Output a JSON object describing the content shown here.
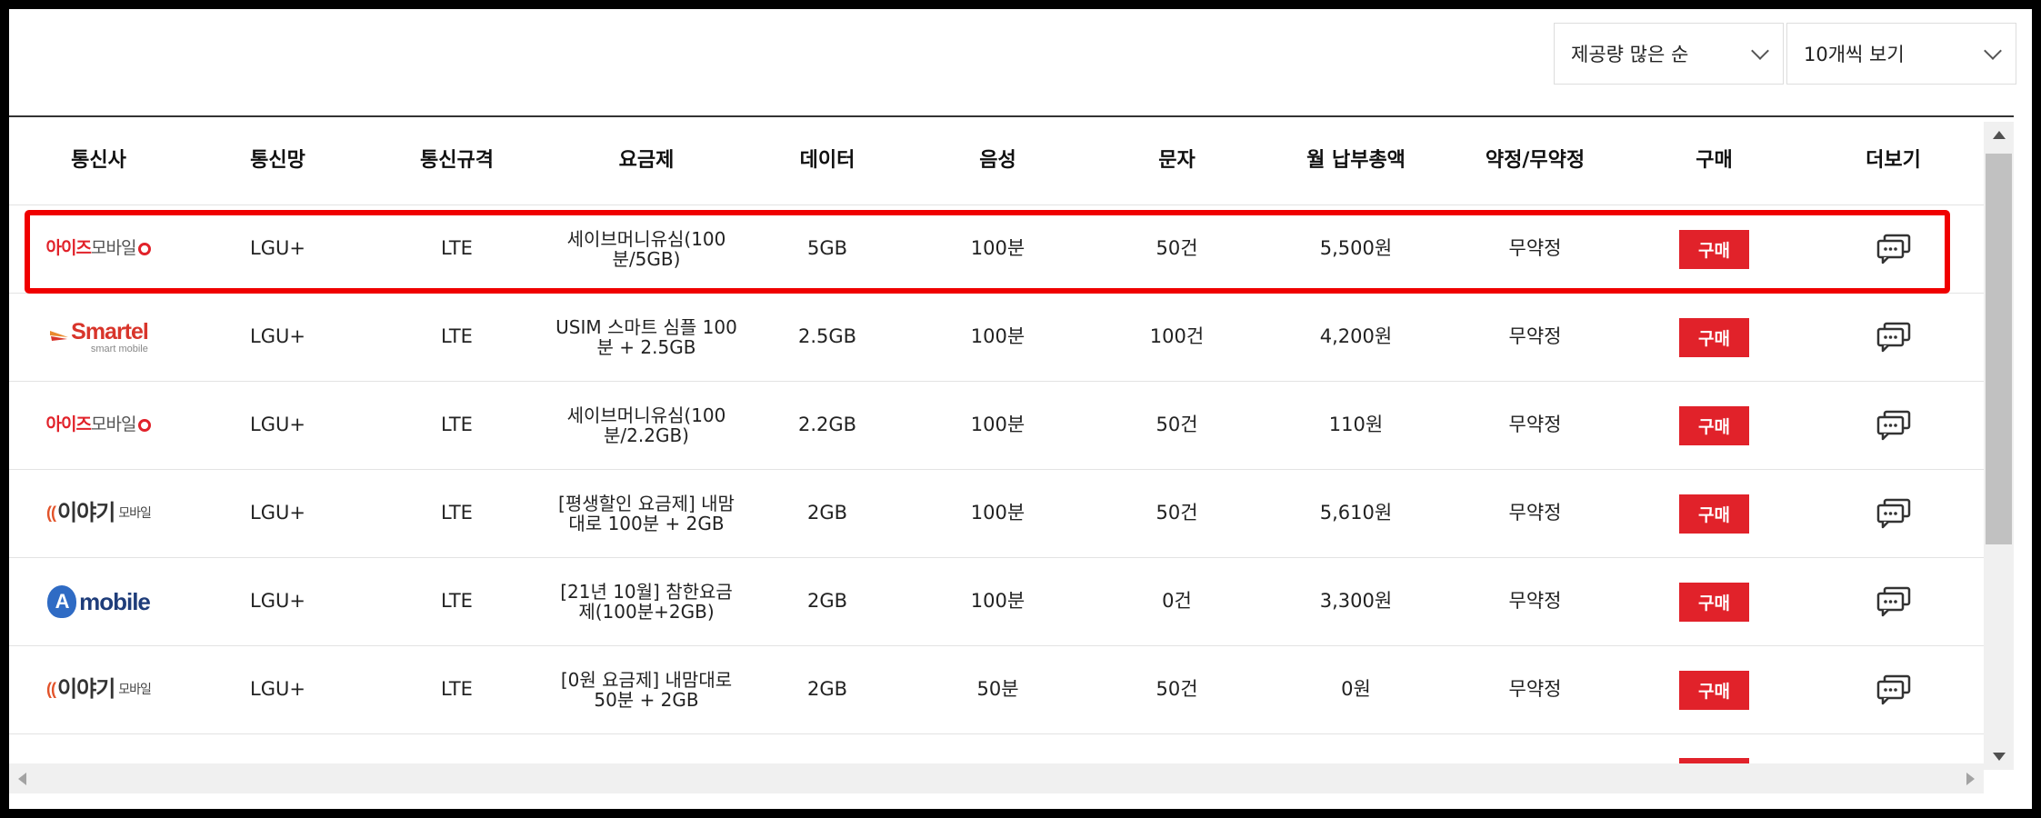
{
  "toolbar": {
    "sort_value": "제공량 많은 순",
    "count_value": "10개씩 보기"
  },
  "table": {
    "headers": [
      "통신사",
      "통신망",
      "통신규격",
      "요금제",
      "데이터",
      "음성",
      "문자",
      "월 납부총액",
      "약정/무약정",
      "구매",
      "더보기"
    ],
    "buy_label": "구매",
    "rows": [
      {
        "carrier": "아이즈모바일",
        "network": "LGU+",
        "standard": "LTE",
        "plan": "세이브머니유심(100분/5GB)",
        "data": "5GB",
        "voice": "100분",
        "sms": "50건",
        "monthly": "5,500원",
        "contract": "무약정"
      },
      {
        "carrier": "Smartel",
        "network": "LGU+",
        "standard": "LTE",
        "plan": "USIM 스마트 심플 100분 + 2.5GB",
        "data": "2.5GB",
        "voice": "100분",
        "sms": "100건",
        "monthly": "4,200원",
        "contract": "무약정"
      },
      {
        "carrier": "아이즈모바일",
        "network": "LGU+",
        "standard": "LTE",
        "plan": "세이브머니유심(100분/2.2GB)",
        "data": "2.2GB",
        "voice": "100분",
        "sms": "50건",
        "monthly": "110원",
        "contract": "무약정"
      },
      {
        "carrier": "이야기 모바일",
        "network": "LGU+",
        "standard": "LTE",
        "plan": "[평생할인 요금제] 내맘대로 100분 + 2GB",
        "data": "2GB",
        "voice": "100분",
        "sms": "50건",
        "monthly": "5,610원",
        "contract": "무약정"
      },
      {
        "carrier": "A mobile",
        "network": "LGU+",
        "standard": "LTE",
        "plan": "[21년 10월] 참한요금제(100분+2GB)",
        "data": "2GB",
        "voice": "100분",
        "sms": "0건",
        "monthly": "3,300원",
        "contract": "무약정"
      },
      {
        "carrier": "이야기 모바일",
        "network": "LGU+",
        "standard": "LTE",
        "plan": "[0원 요금제] 내맘대로 50분 + 2GB",
        "data": "2GB",
        "voice": "50분",
        "sms": "50건",
        "monthly": "0원",
        "contract": "무약정"
      }
    ]
  },
  "logos": {
    "eyes_part1": "아이즈",
    "eyes_part2": "모바일",
    "smartel_main": "Smartel",
    "smartel_sub": "smart mobile",
    "iyagi_main": "이야기",
    "iyagi_sub": "모바일",
    "amobile_letter": "A",
    "amobile_word": "mobile"
  },
  "colors": {
    "accent_red": "#e1222a",
    "highlight_red": "#f00000"
  }
}
